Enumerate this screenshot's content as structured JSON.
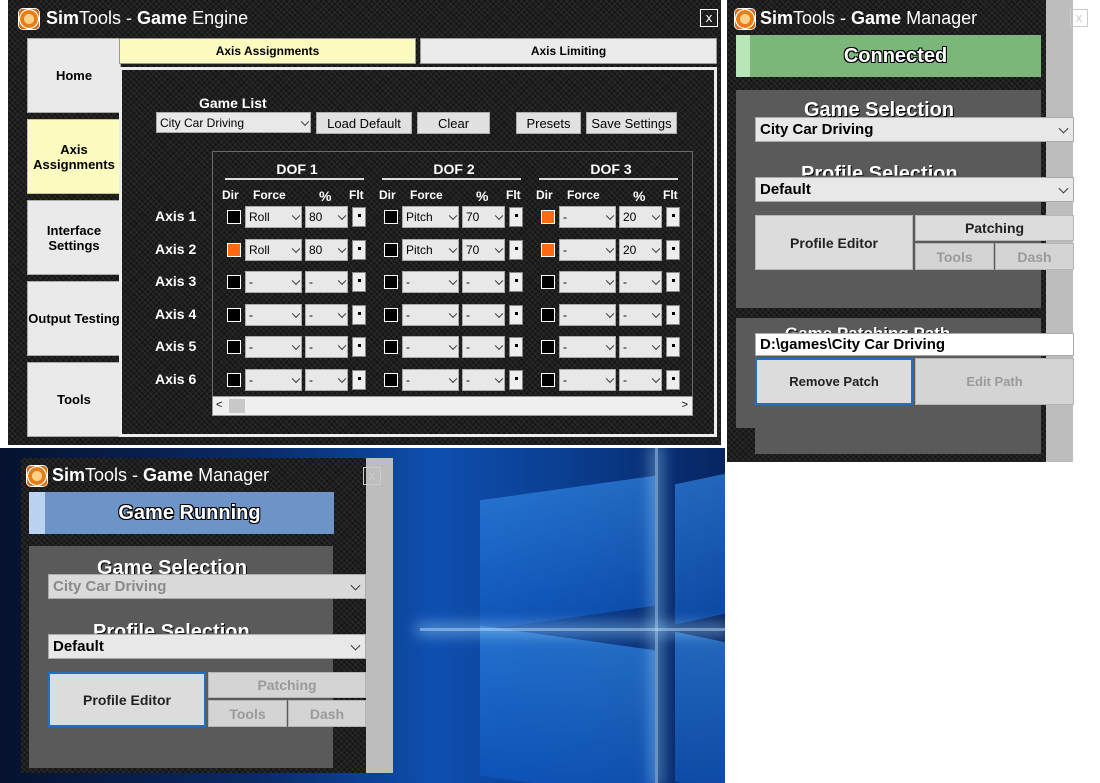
{
  "engine": {
    "title_brand": "Sim",
    "title_rest": "Tools - ",
    "title_bold": "Game",
    "title_tail": " Engine",
    "close": "x",
    "nav": [
      {
        "label": "Home"
      },
      {
        "label": "Axis Assignments"
      },
      {
        "label": "Interface Settings"
      },
      {
        "label": "Output Testing"
      },
      {
        "label": "Tools"
      }
    ],
    "tabs": {
      "assign": "Axis Assignments",
      "limit": "Axis Limiting"
    },
    "game_list_label": "Game List",
    "game_select": "City Car Driving",
    "buttons": {
      "load_default": "Load Default",
      "clear": "Clear",
      "presets": "Presets",
      "save": "Save Settings"
    },
    "dof_headers": [
      "DOF 1",
      "DOF 2",
      "DOF 3"
    ],
    "col_headers": {
      "dir": "Dir",
      "force": "Force",
      "pct": "%",
      "flt": "Flt"
    },
    "axes": [
      {
        "label": "Axis 1",
        "dof": [
          {
            "dir": false,
            "force": "Roll",
            "pct": "80"
          },
          {
            "dir": false,
            "force": "Pitch",
            "pct": "70"
          },
          {
            "dir": true,
            "force": "-",
            "pct": "20"
          }
        ]
      },
      {
        "label": "Axis 2",
        "dof": [
          {
            "dir": true,
            "force": "Roll",
            "pct": "80"
          },
          {
            "dir": false,
            "force": "Pitch",
            "pct": "70"
          },
          {
            "dir": true,
            "force": "-",
            "pct": "20"
          }
        ]
      },
      {
        "label": "Axis 3",
        "dof": [
          {
            "dir": false,
            "force": "-",
            "pct": "-"
          },
          {
            "dir": false,
            "force": "-",
            "pct": "-"
          },
          {
            "dir": false,
            "force": "-",
            "pct": "-"
          }
        ]
      },
      {
        "label": "Axis 4",
        "dof": [
          {
            "dir": false,
            "force": "-",
            "pct": "-"
          },
          {
            "dir": false,
            "force": "-",
            "pct": "-"
          },
          {
            "dir": false,
            "force": "-",
            "pct": "-"
          }
        ]
      },
      {
        "label": "Axis 5",
        "dof": [
          {
            "dir": false,
            "force": "-",
            "pct": "-"
          },
          {
            "dir": false,
            "force": "-",
            "pct": "-"
          },
          {
            "dir": false,
            "force": "-",
            "pct": "-"
          }
        ]
      },
      {
        "label": "Axis 6",
        "dof": [
          {
            "dir": false,
            "force": "-",
            "pct": "-"
          },
          {
            "dir": false,
            "force": "-",
            "pct": "-"
          },
          {
            "dir": false,
            "force": "-",
            "pct": "-"
          }
        ]
      }
    ],
    "scroll_left": "<",
    "scroll_right": ">"
  },
  "manager1": {
    "title_brand": "Sim",
    "title_rest": "Tools - ",
    "title_bold": "Game",
    "title_tail": " Manager",
    "close": "x",
    "status": "Connected",
    "game_selection_label": "Game Selection",
    "game_select": "City Car Driving",
    "profile_selection_label": "Profile Selection",
    "profile_select": "Default",
    "profile_editor": "Profile Editor",
    "patching": "Patching",
    "tools": "Tools",
    "dash": "Dash",
    "patch_label": "Game Patching Path",
    "path": "D:\\games\\City Car Driving",
    "remove_patch": "Remove Patch",
    "edit_path": "Edit Path"
  },
  "manager2": {
    "title_brand": "Sim",
    "title_rest": "Tools - ",
    "title_bold": "Game",
    "title_tail": " Manager",
    "close": "x",
    "status": "Game Running",
    "game_selection_label": "Game Selection",
    "game_select": "City Car Driving",
    "profile_selection_label": "Profile Selection",
    "profile_select": "Default",
    "profile_editor": "Profile Editor",
    "patching": "Patching",
    "tools": "Tools",
    "dash": "Dash"
  },
  "colors": {
    "active_tab": "#fbfbc0",
    "dir_on": "#ff6a13",
    "connected": "#7bb77b",
    "running": "#6d93c7"
  }
}
